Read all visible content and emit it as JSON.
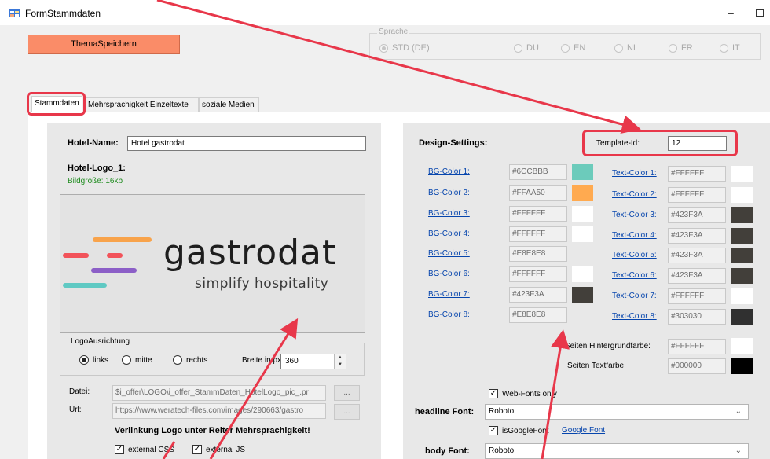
{
  "window": {
    "title": "FormStammdaten",
    "minimize": "–"
  },
  "toolbar": {
    "theme_button": "ThemaSpeichern"
  },
  "language": {
    "title": "Sprache",
    "options": [
      {
        "label": "STD (DE)",
        "selected": true
      },
      {
        "label": "DU",
        "selected": false
      },
      {
        "label": "EN",
        "selected": false
      },
      {
        "label": "NL",
        "selected": false
      },
      {
        "label": "FR",
        "selected": false
      },
      {
        "label": "IT",
        "selected": false
      }
    ]
  },
  "tabs": [
    {
      "label": "Stammdaten",
      "active": true
    },
    {
      "label": "Mehrsprachigkeit Einzeltexte",
      "active": false
    },
    {
      "label": "soziale Medien",
      "active": false
    }
  ],
  "left": {
    "hotel_name_label": "Hotel-Name:",
    "hotel_name_value": "Hotel gastrodat",
    "logo_label": "Hotel-Logo_1:",
    "image_size": "Bildgröße: 16kb",
    "logo": {
      "word": "gastrodat",
      "tagline": "simplify hospitality",
      "bar_colors": [
        "#f8a34b",
        "#f2535a",
        "#f2535a",
        "#8c5fc7",
        "#5fc9c3"
      ]
    },
    "alignment": {
      "title": "LogoAusrichtung",
      "options": [
        {
          "label": "links",
          "selected": true
        },
        {
          "label": "mitte",
          "selected": false
        },
        {
          "label": "rechts",
          "selected": false
        }
      ],
      "width_label": "Breite in px:",
      "width_value": "360"
    },
    "file_label": "Datei:",
    "file_value": "$i_offer\\LOGO\\i_offer_StammDaten_HotelLogo_pic_.pr",
    "url_label": "Url:",
    "url_value": "https://www.weratech-files.com/images/290663/gastro",
    "dots": "...",
    "link_heading": "Verlinkung Logo unter Reiter Mehrsprachigkeit!",
    "checkboxes": [
      {
        "label": "external CSS",
        "checked": true
      },
      {
        "label": "external JS",
        "checked": true
      }
    ]
  },
  "right": {
    "design_title": "Design-Settings:",
    "template_label": "Template-Id:",
    "template_value": "12",
    "bg_colors": [
      {
        "label": "BG-Color 1:",
        "hex": "#6CCBBB",
        "swatch": "#6CCBBB"
      },
      {
        "label": "BG-Color 2:",
        "hex": "#FFAA50",
        "swatch": "#FFAA50"
      },
      {
        "label": "BG-Color 3:",
        "hex": "#FFFFFF",
        "swatch": "#FFFFFF"
      },
      {
        "label": "BG-Color 4:",
        "hex": "#FFFFFF",
        "swatch": "#FFFFFF"
      },
      {
        "label": "BG-Color 5:",
        "hex": "#E8E8E8",
        "swatch": "#E8E8E8"
      },
      {
        "label": "BG-Color 6:",
        "hex": "#FFFFFF",
        "swatch": "#FFFFFF"
      },
      {
        "label": "BG-Color 7:",
        "hex": "#423F3A",
        "swatch": "#423F3A"
      },
      {
        "label": "BG-Color 8:",
        "hex": "#E8E8E8",
        "swatch": "#E8E8E8"
      }
    ],
    "text_colors": [
      {
        "label": "Text-Color 1:",
        "hex": "#FFFFFF",
        "swatch": "#FFFFFF"
      },
      {
        "label": "Text-Color 2:",
        "hex": "#FFFFFF",
        "swatch": "#FFFFFF"
      },
      {
        "label": "Text-Color 3:",
        "hex": "#423F3A",
        "swatch": "#423F3A"
      },
      {
        "label": "Text-Color 4:",
        "hex": "#423F3A",
        "swatch": "#423F3A"
      },
      {
        "label": "Text-Color 5:",
        "hex": "#423F3A",
        "swatch": "#423F3A"
      },
      {
        "label": "Text-Color 6:",
        "hex": "#423F3A",
        "swatch": "#423F3A"
      },
      {
        "label": "Text-Color 7:",
        "hex": "#FFFFFF",
        "swatch": "#FFFFFF"
      },
      {
        "label": "Text-Color 8:",
        "hex": "#303030",
        "swatch": "#303030"
      }
    ],
    "page_bg_label": "Seiten Hintergrundfarbe:",
    "page_bg_value": "#FFFFFF",
    "page_bg_swatch": "#FFFFFF",
    "page_text_label": "Seiten Textfarbe:",
    "page_text_value": "#000000",
    "page_text_swatch": "#000000",
    "webfonts_label": "Web-Fonts only",
    "webfonts_checked": true,
    "headline_font_label": "headline Font:",
    "headline_font_value": "Roboto",
    "is_google_label": "isGoogleFont",
    "is_google_checked": true,
    "google_font_link": "Google Font",
    "body_font_label": "body Font:",
    "body_font_value": "Roboto"
  },
  "colors": {
    "highlight": "#e8374a",
    "theme_button": "#fa8c68",
    "link": "#0645ad"
  }
}
